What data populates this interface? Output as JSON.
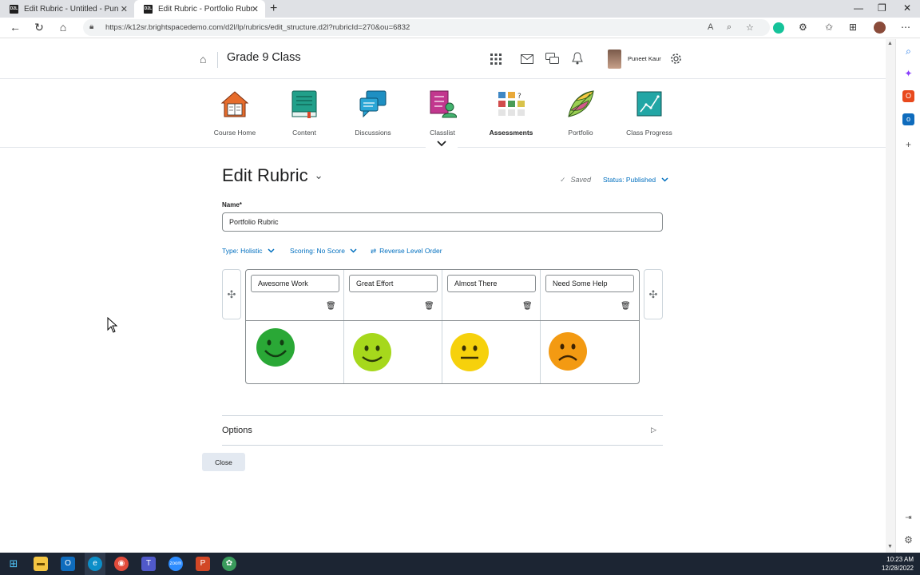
{
  "browser": {
    "tabs": [
      {
        "label": "Edit Rubric - Untitled - Puneet's",
        "favicon": "D2L",
        "active": false
      },
      {
        "label": "Edit Rubric - Portfolio Rubric - B",
        "favicon": "D2L",
        "active": true
      }
    ],
    "url": "https://k12sr.brightspacedemo.com/d2l/lp/rubrics/edit_structure.d2l?rubricId=270&ou=6832"
  },
  "header": {
    "course_title": "Grade 9 Class",
    "user_name": "Puneet Kaur"
  },
  "nav": {
    "items": [
      {
        "label": "Course Home",
        "icon": "house-book-icon"
      },
      {
        "label": "Content",
        "icon": "book-icon"
      },
      {
        "label": "Discussions",
        "icon": "chat-bubbles-icon"
      },
      {
        "label": "Classlist",
        "icon": "class-list-icon"
      },
      {
        "label": "Assessments",
        "icon": "assessments-grid-icon"
      },
      {
        "label": "Portfolio",
        "icon": "feather-icon"
      },
      {
        "label": "Class Progress",
        "icon": "chart-line-icon"
      }
    ]
  },
  "main": {
    "page_title": "Edit Rubric",
    "saved_label": "Saved",
    "status_label": "Status: Published",
    "name_label": "Name*",
    "name_value": "Portfolio Rubric",
    "type_label": "Type: Holistic",
    "scoring_label": "Scoring: No Score",
    "reverse_label": "Reverse Level Order",
    "levels": [
      {
        "name": "Awesome Work",
        "face": "big-smile",
        "color": "#2aa836"
      },
      {
        "name": "Great Effort",
        "face": "smile",
        "color": "#a6d81c"
      },
      {
        "name": "Almost There",
        "face": "neutral",
        "color": "#f6d10c"
      },
      {
        "name": "Need Some Help",
        "face": "frown",
        "color": "#f39a12"
      }
    ],
    "options_label": "Options",
    "close_label": "Close"
  },
  "taskbar": {
    "time": "10:23 AM",
    "date": "12/28/2022"
  },
  "colors": {
    "link": "#006fbf",
    "accent_bar": "#e8590c",
    "taskbar": "#1c2533"
  }
}
